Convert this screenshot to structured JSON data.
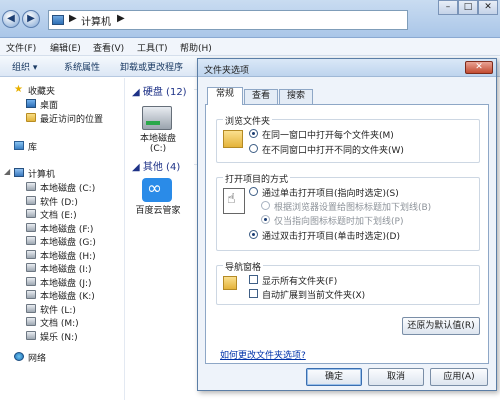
{
  "window": {
    "address_path": "计算机",
    "address_arrow": "▶"
  },
  "menubar": [
    {
      "label": "文件(F)"
    },
    {
      "label": "编辑(E)"
    },
    {
      "label": "查看(V)"
    },
    {
      "label": "工具(T)"
    },
    {
      "label": "帮助(H)"
    }
  ],
  "toolbar": [
    {
      "label": "组织 ▾"
    },
    {
      "label": "系统属性"
    },
    {
      "label": "卸载或更改程序"
    }
  ],
  "sidebar": {
    "favorites": {
      "label": "收藏夹",
      "items": [
        {
          "label": "桌面"
        },
        {
          "label": "最近访问的位置"
        }
      ]
    },
    "library": {
      "label": "库"
    },
    "computer": {
      "label": "计算机",
      "drives": [
        {
          "label": "本地磁盘 (C:)"
        },
        {
          "label": "软件 (D:)"
        },
        {
          "label": "文档 (E:)"
        },
        {
          "label": "本地磁盘 (F:)"
        },
        {
          "label": "本地磁盘 (G:)"
        },
        {
          "label": "本地磁盘 (H:)"
        },
        {
          "label": "本地磁盘 (I:)"
        },
        {
          "label": "本地磁盘 (J:)"
        },
        {
          "label": "本地磁盘 (K:)"
        },
        {
          "label": "软件 (L:)"
        },
        {
          "label": "文档 (M:)"
        },
        {
          "label": "娱乐 (N:)"
        }
      ]
    },
    "network": {
      "label": "网络"
    }
  },
  "main": {
    "group_drives": "硬盘 (12)",
    "group_other": "其他 (4)",
    "tiles": [
      {
        "label": "本地磁盘",
        "sub": "(C:)"
      },
      {
        "label": "百度云管家",
        "sub": ""
      }
    ]
  },
  "dialog": {
    "title": "文件夹选项",
    "close_glyph": "✕",
    "tabs": [
      {
        "label": "常规"
      },
      {
        "label": "查看"
      },
      {
        "label": "搜索"
      }
    ],
    "browse": {
      "title": "浏览文件夹",
      "options": [
        {
          "label": "在同一窗口中打开每个文件夹(M)"
        },
        {
          "label": "在不同窗口中打开不同的文件夹(W)"
        }
      ]
    },
    "open": {
      "title": "打开项目的方式",
      "options": [
        {
          "label": "通过单击打开项目(指向时选定)(S)"
        },
        {
          "label": "根据浏览器设置给图标标题加下划线(B)"
        },
        {
          "label": "仅当指向图标标题时加下划线(P)"
        },
        {
          "label": "通过双击打开项目(单击时选定)(D)"
        }
      ]
    },
    "nav": {
      "title": "导航窗格",
      "options": [
        {
          "label": "显示所有文件夹(F)"
        },
        {
          "label": "自动扩展到当前文件夹(X)"
        }
      ]
    },
    "restore_button": "还原为默认值(R)",
    "help_link": "如何更改文件夹选项?",
    "ok_button": "确定",
    "cancel_button": "取消",
    "apply_button": "应用(A)"
  }
}
